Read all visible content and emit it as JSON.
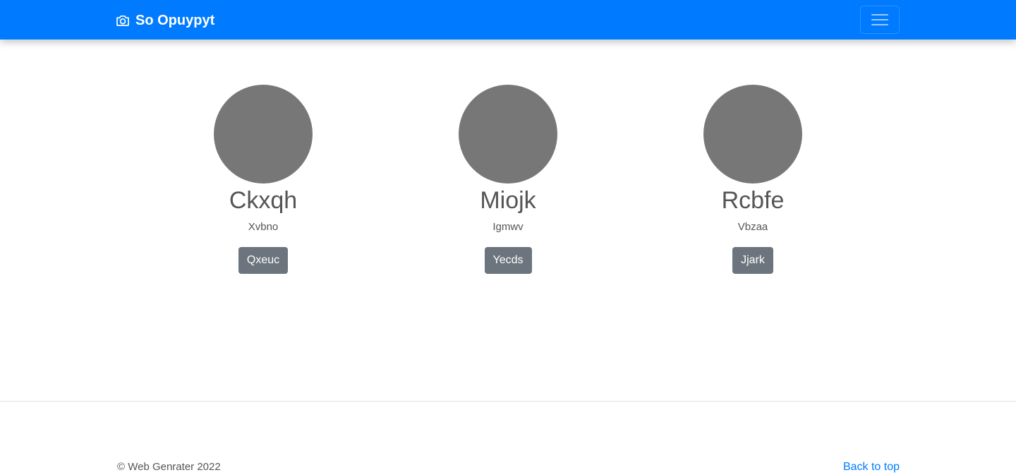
{
  "navbar": {
    "brand_icon": "camera-icon",
    "brand_text": "So Opuypyt",
    "toggler_icon": "hamburger-menu-icon",
    "background": "#007bff"
  },
  "people": [
    {
      "name": "Ckxqh",
      "subtitle": "Xvbno",
      "button": "Qxeuc"
    },
    {
      "name": "Miojk",
      "subtitle": "Igmwv",
      "button": "Yecds"
    },
    {
      "name": "Rcbfe",
      "subtitle": "Vbzaa",
      "button": "Jjark"
    }
  ],
  "footer": {
    "copyright": "© Web Genrater 2022",
    "back_to_top": "Back to top",
    "link_color": "#007bff"
  },
  "colors": {
    "avatar": "#777777",
    "button": "#6c757d"
  }
}
